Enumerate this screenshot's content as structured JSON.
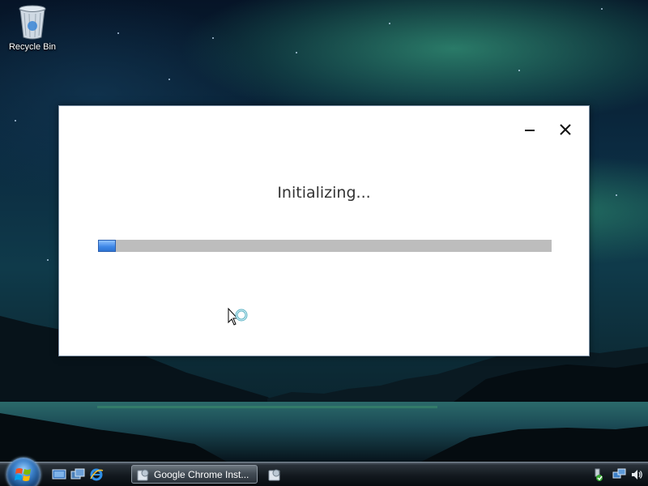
{
  "desktop": {
    "recycle_bin_label": "Recycle Bin"
  },
  "installer": {
    "status": "Initializing...",
    "progress_percent": 4
  },
  "taskbar": {
    "start_icon": "windows-start-orb",
    "quick_launch": [
      "show-desktop-icon",
      "switch-windows-icon",
      "internet-explorer-icon"
    ],
    "tasks": [
      {
        "label": "Google Chrome Inst...",
        "icon": "installer-icon",
        "active": true
      }
    ],
    "tray_icons": [
      "safely-remove-hardware-icon",
      "network-icon",
      "volume-icon"
    ]
  },
  "colors": {
    "progress_fill": "#3d86e6",
    "progress_track": "#bdbdbd",
    "dialog_bg": "#ffffff"
  }
}
